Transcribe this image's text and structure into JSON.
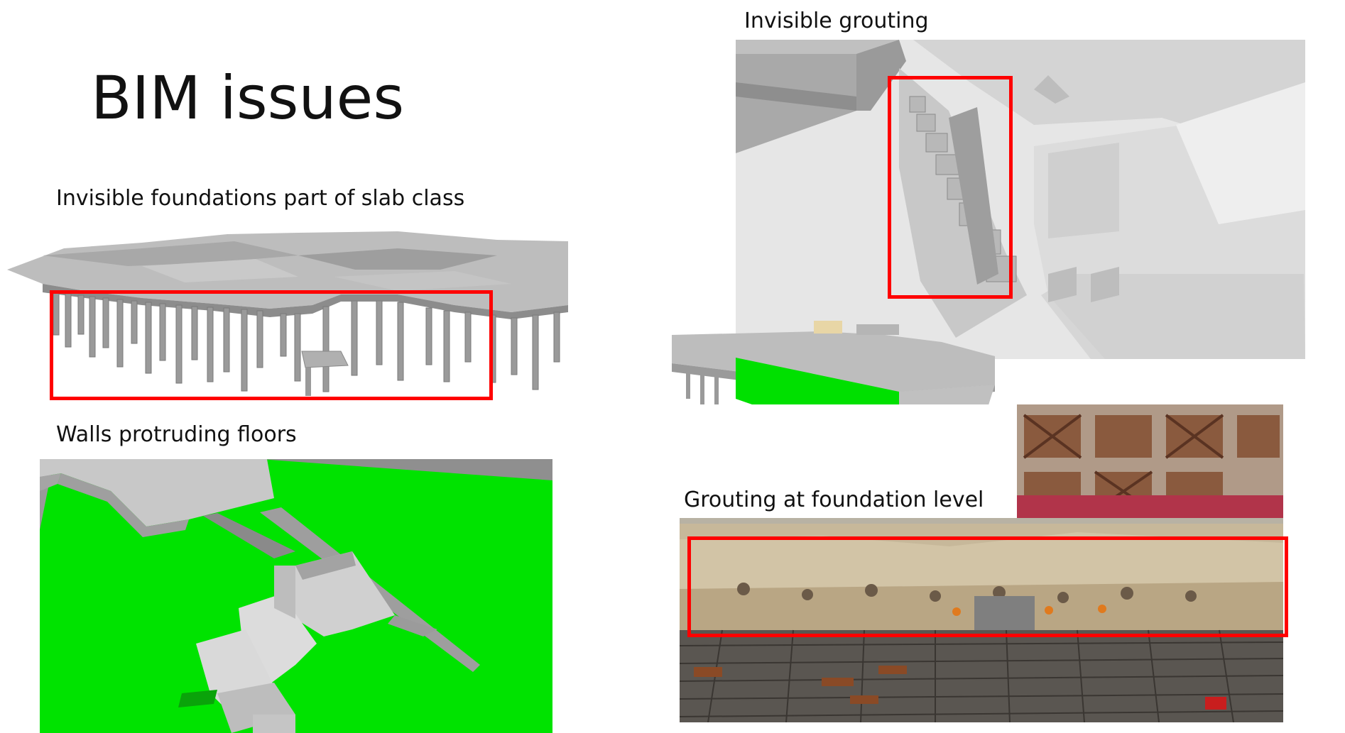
{
  "slide": {
    "title": "BIM issues"
  },
  "sections": {
    "foundations_caption": "Invisible foundations part of slab class",
    "walls_caption": "Walls protruding floors",
    "grouting_caption": "Invisible grouting",
    "foundation_level_caption": "Grouting at foundation level"
  },
  "colors": {
    "highlight_box": "#ff0000",
    "wall_green": "#00e000",
    "model_grey": "#b8b8b8"
  }
}
